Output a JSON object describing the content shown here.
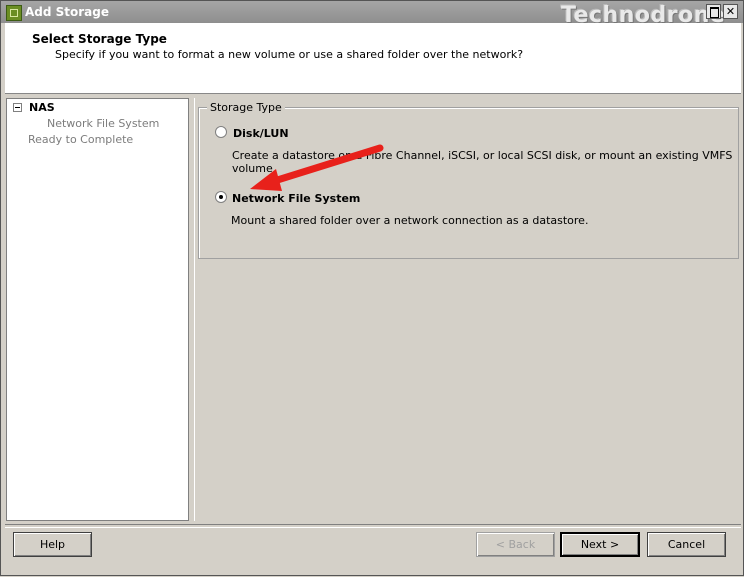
{
  "window": {
    "title": "Add Storage",
    "watermark": "Technodrone",
    "controls": {
      "maximize": "",
      "close": "✕"
    }
  },
  "header": {
    "title": "Select Storage Type",
    "subtitle": "Specify if you want to format a new volume or use a shared folder over the network?"
  },
  "nav": {
    "items": [
      {
        "label": "NAS"
      },
      {
        "label": "Network File System"
      },
      {
        "label": "Ready to Complete"
      }
    ]
  },
  "storage_type": {
    "legend": "Storage Type",
    "options": [
      {
        "label": "Disk/LUN",
        "description": "Create a datastore on a Fibre Channel, iSCSI, or local SCSI disk, or mount an existing VMFS volume.",
        "selected": false
      },
      {
        "label": "Network File System",
        "description": "Mount a shared folder over a network connection as a datastore.",
        "selected": true
      }
    ]
  },
  "buttons": {
    "help": "Help",
    "back": "< Back",
    "next": "Next >",
    "cancel": "Cancel"
  },
  "colors": {
    "annotation_arrow": "#e8211b"
  }
}
